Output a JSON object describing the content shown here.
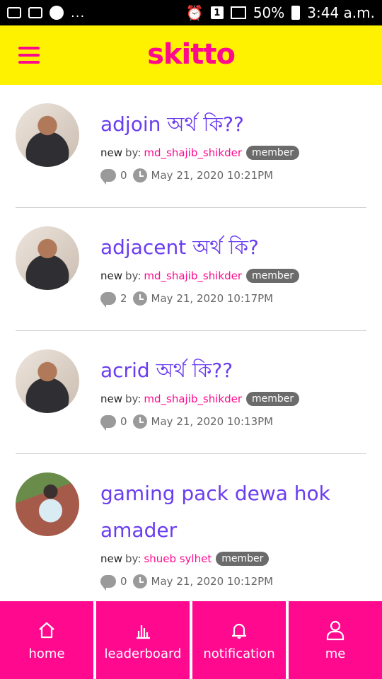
{
  "status_bar": {
    "battery": "50%",
    "time": "3:44 a.m.",
    "sim": "1",
    "dots": "..."
  },
  "app": {
    "brand": "skitto",
    "accent": "#ff0a8f",
    "header_bg": "#fff200",
    "title_color": "#6a3df0"
  },
  "posts": [
    {
      "title": "adjoin অর্থ কি??",
      "tag": "new",
      "by": "by:",
      "author": "md_shajib_shikder",
      "badge": "member",
      "comments": "0",
      "date": "May 21, 2020 10:21PM"
    },
    {
      "title": "adjacent অর্থ কি?",
      "tag": "new",
      "by": "by:",
      "author": "md_shajib_shikder",
      "badge": "member",
      "comments": "2",
      "date": "May 21, 2020 10:17PM"
    },
    {
      "title": "acrid অর্থ কি??",
      "tag": "new",
      "by": "by:",
      "author": "md_shajib_shikder",
      "badge": "member",
      "comments": "0",
      "date": "May 21, 2020 10:13PM"
    },
    {
      "title": "gaming pack dewa hok amader",
      "tag": "new",
      "by": "by:",
      "author": "shueb sylhet",
      "badge": "member",
      "comments": "0",
      "date": "May 21, 2020 10:12PM"
    }
  ],
  "nav": {
    "home": "home",
    "leaderboard": "leaderboard",
    "notification": "notification",
    "me": "me"
  }
}
